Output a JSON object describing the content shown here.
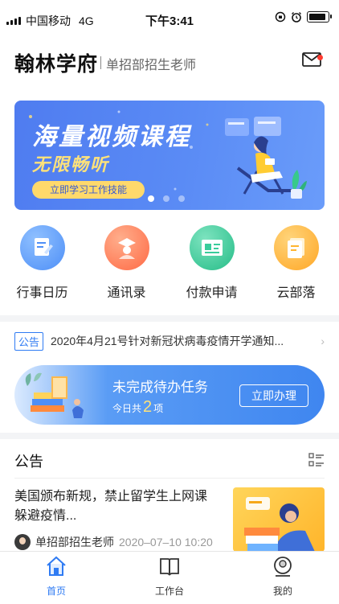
{
  "status": {
    "carrier": "中国移动",
    "network": "4G",
    "time": "下午3:41"
  },
  "header": {
    "app_title": "翰林学府",
    "role": "单招部招生老师",
    "mail_icon": "mail-icon"
  },
  "banner": {
    "title": "海量视频课程",
    "subtitle": "无限畅听",
    "button": "立即学习工作技能",
    "slides": 3,
    "active_slide": 1
  },
  "quick_actions": [
    {
      "label": "行事日历",
      "icon": "calendar-icon",
      "color": "#4e8ff7"
    },
    {
      "label": "通讯录",
      "icon": "contacts-icon",
      "color": "#ff7a56"
    },
    {
      "label": "付款申请",
      "icon": "payment-icon",
      "color": "#39cc9b"
    },
    {
      "label": "云部落",
      "icon": "cloud-tribe-icon",
      "color": "#ffb530"
    }
  ],
  "notice": {
    "tag": "公告",
    "text": "2020年4月21号针对新冠状病毒疫情开学通知..."
  },
  "todo": {
    "title": "未完成待办任务",
    "count_prefix": "今日共",
    "count": "2",
    "count_suffix": "项",
    "button": "立即办理"
  },
  "announcements": {
    "title": "公告",
    "items": [
      {
        "title": "美国颁布新规，禁止留学生上网课躲避疫情...",
        "author": "单招部招生老师",
        "date": "2020–07–10 10:20"
      }
    ]
  },
  "tabbar": [
    {
      "label": "首页",
      "icon": "home-icon",
      "active": true
    },
    {
      "label": "工作台",
      "icon": "workbench-icon",
      "active": false
    },
    {
      "label": "我的",
      "icon": "profile-icon",
      "active": false
    }
  ],
  "colors": {
    "accent": "#2f7bf3",
    "banner_yellow": "#ffd96b",
    "unread_dot": "#ff3b30"
  }
}
